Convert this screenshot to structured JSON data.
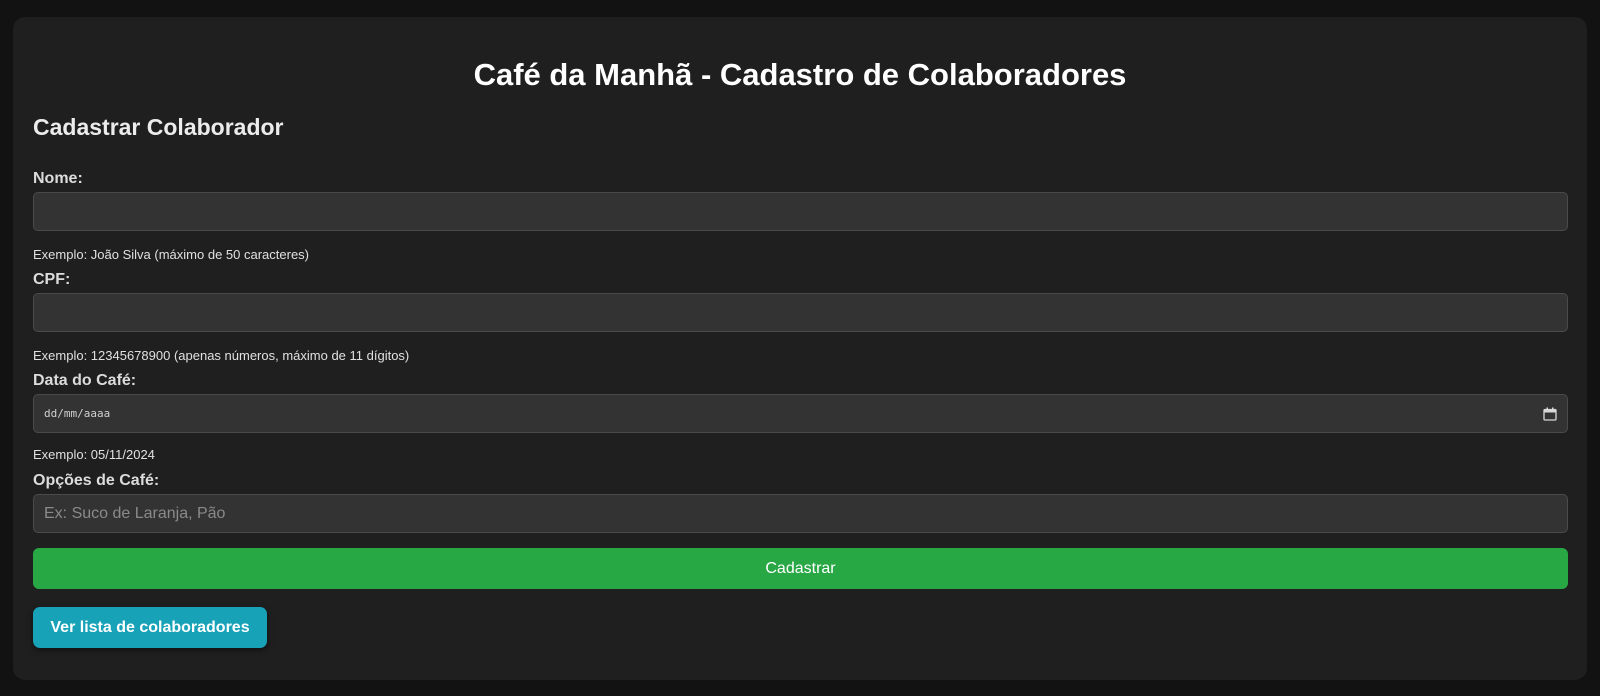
{
  "header": {
    "title": "Café da Manhã - Cadastro de Colaboradores",
    "section_title": "Cadastrar Colaborador"
  },
  "form": {
    "nome": {
      "label": "Nome:",
      "value": "",
      "hint": "Exemplo: João Silva (máximo de 50 caracteres)"
    },
    "cpf": {
      "label": "CPF:",
      "value": "",
      "hint": "Exemplo: 12345678900 (apenas números, máximo de 11 dígitos)"
    },
    "data": {
      "label": "Data do Café:",
      "placeholder": "dd/mm/aaaa",
      "hint": "Exemplo: 05/11/2024",
      "icon": "calendar-icon"
    },
    "opcoes": {
      "label": "Opções de Café:",
      "value": "",
      "placeholder": "Ex: Suco de Laranja, Pão"
    },
    "submit_label": "Cadastrar"
  },
  "actions": {
    "list_label": "Ver lista de colaboradores"
  },
  "colors": {
    "background": "#121212",
    "card": "#1f1f1f",
    "input": "#333333",
    "submit": "#28a745",
    "list_button": "#17a2b8"
  }
}
